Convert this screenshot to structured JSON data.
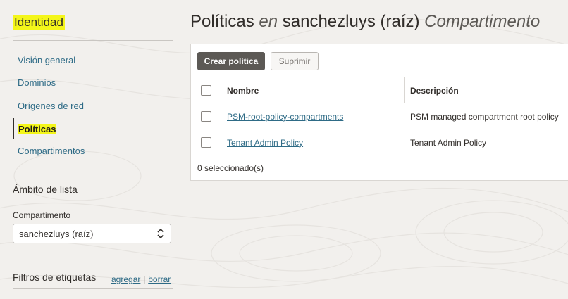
{
  "sidebar": {
    "title": "Identidad",
    "nav_items": [
      {
        "label": "Visión general",
        "active": false
      },
      {
        "label": "Dominios",
        "active": false
      },
      {
        "label": "Orígenes de red",
        "active": false
      },
      {
        "label": "Políticas",
        "active": true
      },
      {
        "label": "Compartimentos",
        "active": false
      }
    ],
    "scope_heading": "Ámbito de lista",
    "compartment_label": "Compartimento",
    "compartment_value": "sanchezluys (raíz)",
    "tag_filters_label": "Filtros de etiquetas",
    "tag_add": "agregar",
    "tag_clear": "borrar"
  },
  "page": {
    "title_prefix": "Políticas",
    "title_en": "en",
    "title_scope": "sanchezluys (raíz)",
    "title_suffix": "Compartimento"
  },
  "toolbar": {
    "create_label": "Crear política",
    "delete_label": "Suprimir"
  },
  "table": {
    "headers": {
      "name": "Nombre",
      "description": "Descripción"
    },
    "rows": [
      {
        "name": "PSM-root-policy-compartments",
        "description": "PSM managed compartment root policy"
      },
      {
        "name": "Tenant Admin Policy",
        "description": "Tenant Admin Policy"
      }
    ],
    "selection_status": "0 seleccionado(s)"
  },
  "colors": {
    "highlight": "#f4f61a",
    "link": "#2e6b86",
    "primary_button": "#5c5955"
  }
}
